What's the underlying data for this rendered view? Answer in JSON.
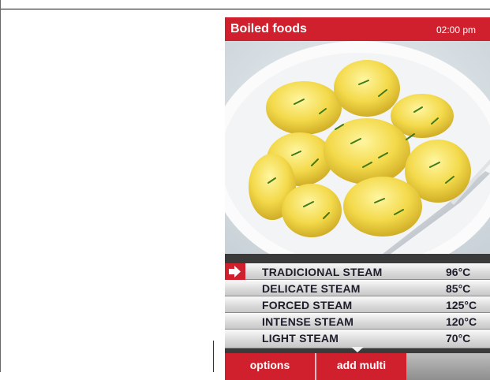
{
  "header": {
    "title": "Boiled foods",
    "time": "02:00 pm"
  },
  "photo": {
    "subject": "boiled potatoes with dill on a white plate with a fork"
  },
  "modes": [
    {
      "name": "TRADICIONAL STEAM",
      "temp": "96°C",
      "selected": true
    },
    {
      "name": "DELICATE STEAM",
      "temp": "85°C",
      "selected": false
    },
    {
      "name": "FORCED STEAM",
      "temp": "125°C",
      "selected": false
    },
    {
      "name": "INTENSE STEAM",
      "temp": "120°C",
      "selected": false
    },
    {
      "name": "LIGHT STEAM",
      "temp": "70°C",
      "selected": false
    }
  ],
  "footer": {
    "options_label": "options",
    "add_multi_label": "add multi"
  },
  "icons": {
    "selected_marker": "right-arrow-icon",
    "scroll": "chevron-down-icon"
  },
  "colors": {
    "accent": "#d0202e",
    "row_text": "#1d1d2b"
  }
}
